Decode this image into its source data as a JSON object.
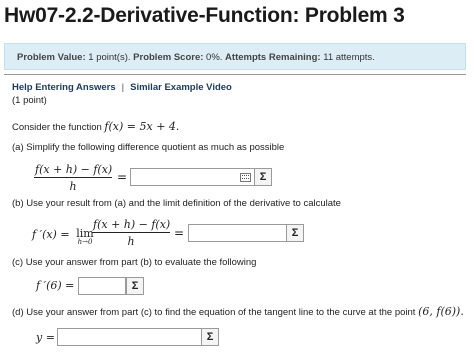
{
  "page": {
    "title": "Hw07-2.2-Derivative-Function: Problem 3"
  },
  "info": {
    "problem_value_label": "Problem Value:",
    "problem_value": "1 point(s).",
    "problem_score_label": "Problem Score:",
    "problem_score": "0%.",
    "attempts_label": "Attempts Remaining:",
    "attempts": "11 attempts."
  },
  "links": {
    "help": "Help Entering Answers",
    "separator": "|",
    "video": "Similar Example Video"
  },
  "points": "(1 point)",
  "problem": {
    "intro_text": "Consider the function",
    "function": "f(x) = 5x + 4.",
    "part_a": "(a)   Simplify the following difference quotient as much as possible",
    "part_b": "(b)   Use your result from (a) and the limit definition of the derivative to calculate",
    "part_c": "(c)   Use your answer from part (b) to evaluate the following",
    "part_d_text": "(d) Use your answer from part (c) to find the equation of the tangent line to the curve at the point",
    "part_d_point": "(6, f(6))."
  },
  "math": {
    "dq_numerator": "f(x + h) − f(x)",
    "dq_denominator": "h",
    "equals": "=",
    "fprime_x": "f ′(x) =",
    "lim": "lim",
    "lim_sub": "h→0",
    "fprime_6": "f ′(6) =",
    "y_eq": "y ="
  },
  "buttons": {
    "sigma": "Σ"
  },
  "icons": {
    "keyboard": "keyboard-icon",
    "sigma": "sigma-icon"
  },
  "colors": {
    "info_bg": "#dcedf6",
    "link": "#1c3a5a"
  }
}
